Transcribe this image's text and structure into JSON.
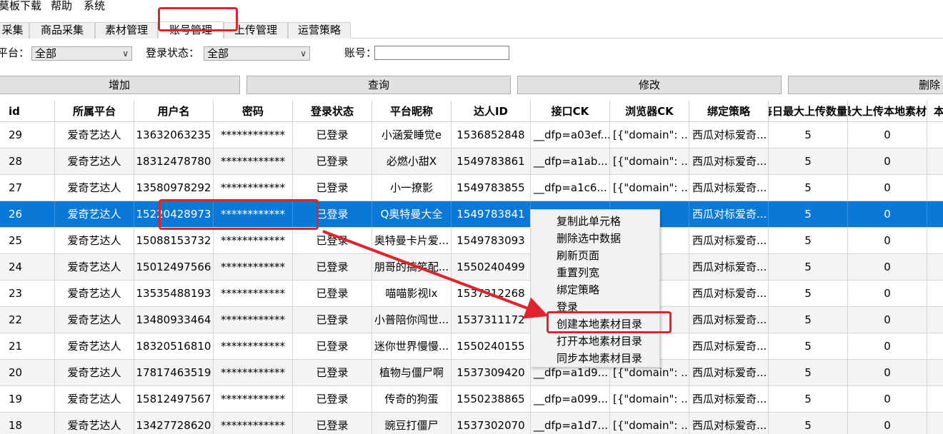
{
  "menu": [
    "莫板下载",
    "帮助",
    "系统"
  ],
  "tabs": [
    {
      "label": "采集",
      "active": false
    },
    {
      "label": "商品采集",
      "active": false
    },
    {
      "label": "素材管理",
      "active": false
    },
    {
      "label": "账号管理",
      "active": true
    },
    {
      "label": "上传管理",
      "active": false
    },
    {
      "label": "运营策略",
      "active": false
    }
  ],
  "filters": {
    "platform_label": "平台：",
    "platform_value": "全部",
    "login_label": "登录状态：",
    "login_value": "全部",
    "account_label": "账号：",
    "account_value": ""
  },
  "buttons": {
    "add": "增加",
    "query": "查询",
    "edit": "修改",
    "delete": "删除"
  },
  "columns": [
    "id",
    "所属平台",
    "用户名",
    "密码",
    "登录状态",
    "平台昵称",
    "达人ID",
    "接口CK",
    "浏览器CK",
    "绑定策略",
    "每日最大上传数量",
    "最大上传本地素材",
    "本地"
  ],
  "rows": [
    [
      "29",
      "爱奇艺达人",
      "13632063235",
      "************",
      "已登录",
      "小涵爱睡觉e",
      "1536852848",
      "__dfp=a03ef...",
      "[{\"domain\": ...",
      "西瓜对标爱奇...",
      "5",
      "0"
    ],
    [
      "28",
      "爱奇艺达人",
      "18312478780",
      "************",
      "已登录",
      "必燃小甜X",
      "1549783861",
      "__dfp=a1ab...",
      "[{\"domain\": ...",
      "西瓜对标爱奇...",
      "5",
      "0"
    ],
    [
      "27",
      "爱奇艺达人",
      "13580978292",
      "************",
      "已登录",
      "小一撩影",
      "1549783855",
      "__dfp=a1c6...",
      "[{\"domain\": ...",
      "西瓜对标爱奇...",
      "5",
      "0"
    ],
    [
      "26",
      "爱奇艺达人",
      "15220428973",
      "************",
      "已登录",
      "Q奥特曼大全",
      "1549783841",
      "",
      "...n\": ...",
      "西瓜对标爱奇...",
      "5",
      "0"
    ],
    [
      "25",
      "爱奇艺达人",
      "15088153732",
      "************",
      "已登录",
      "奥特曼卡片爱...",
      "1549783093",
      "",
      "...n\": ...",
      "西瓜对标爱奇...",
      "5",
      "0"
    ],
    [
      "24",
      "爱奇艺达人",
      "15012497566",
      "************",
      "已登录",
      "朋哥的搞笑配...",
      "1550240499",
      "",
      "...n\": ...",
      "西瓜对标爱奇...",
      "5",
      "0"
    ],
    [
      "23",
      "爱奇艺达人",
      "13535488193",
      "************",
      "已登录",
      "喵喵影视lx",
      "1537312268",
      "",
      "...n\": ...",
      "西瓜对标爱奇...",
      "5",
      "0"
    ],
    [
      "22",
      "爱奇艺达人",
      "13480933464",
      "************",
      "已登录",
      "小普陪你闯世...",
      "1537311172",
      "",
      "...n\": ...",
      "西瓜对标爱奇...",
      "5",
      "0"
    ],
    [
      "21",
      "爱奇艺达人",
      "18320516810",
      "************",
      "已登录",
      "迷你世界慢慢...",
      "1550240155",
      "",
      "...n\": ...",
      "西瓜对标爱奇...",
      "5",
      "0"
    ],
    [
      "20",
      "爱奇艺达人",
      "17817463519",
      "************",
      "已登录",
      "植物与僵尸啊",
      "1537309420",
      "__dfp=a1d9...",
      "[{\"domain\": ...",
      "西瓜对标爱奇...",
      "5",
      "0"
    ],
    [
      "19",
      "爱奇艺达人",
      "15812497567",
      "************",
      "已登录",
      "传奇的狗蛋",
      "1550238865",
      "__dfp=a099...",
      "[{\"domain\": ...",
      "西瓜对标爱奇...",
      "5",
      "0"
    ],
    [
      "18",
      "爱奇艺达人",
      "13427728620",
      "************",
      "已登录",
      "豌豆打僵尸",
      "1537302070",
      "__dfp=a1d7...",
      "[{\"domain\": ...",
      "西瓜对标爱奇...",
      "5",
      "0"
    ]
  ],
  "context_menu": [
    "复制此单元格",
    "删除选中数据",
    "刷新页面",
    "重置列宽",
    "绑定策略",
    "登录",
    "创建本地素材目录",
    "打开本地素材目录",
    "同步本地素材目录"
  ],
  "colors": {
    "selection": "#0a78d7",
    "highlight": "#e0242b"
  }
}
